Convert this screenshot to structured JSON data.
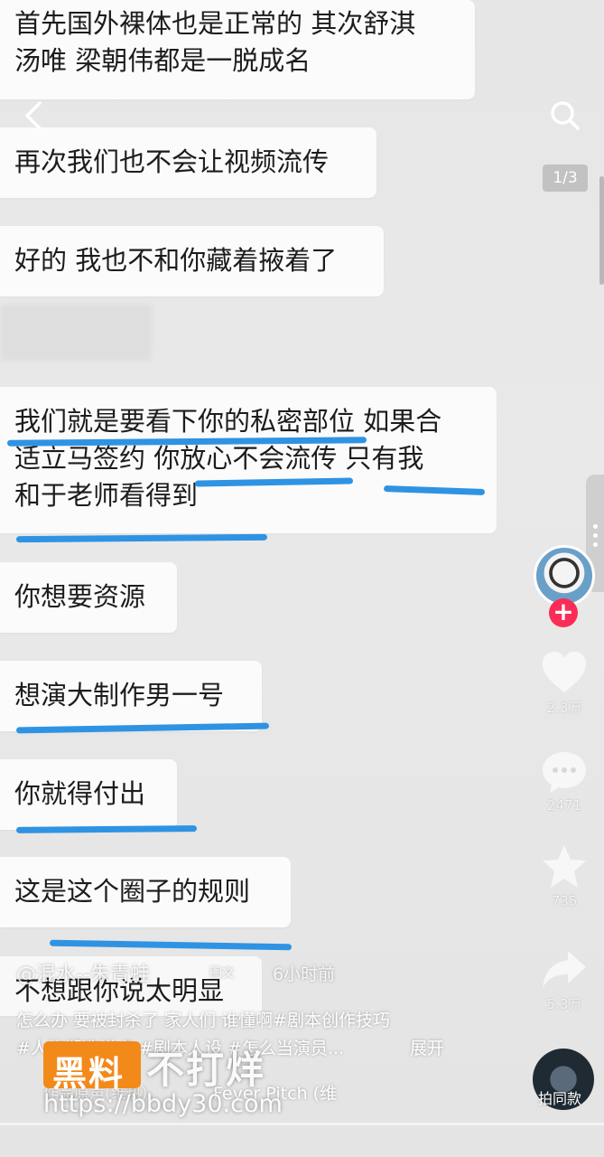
{
  "chat": {
    "messages": [
      {
        "lines": [
          "首先国外裸体也是正常的 其次舒淇",
          "汤唯 梁朝伟都是一脱成名"
        ]
      },
      {
        "lines": [
          "再次我们也不会让视频流传"
        ]
      },
      {
        "lines": [
          "好的 我也不和你藏着掖着了"
        ]
      },
      {
        "lines": [
          "我们就是要看下你的私密部位 如果合",
          "适立马签约 你放心不会流传 只有我",
          "和于老师看得到"
        ]
      },
      {
        "lines": [
          "你想要资源"
        ]
      },
      {
        "lines": [
          "想演大制作男一号"
        ]
      },
      {
        "lines": [
          "你就得付出"
        ]
      },
      {
        "lines": [
          "这是这个圈子的规则"
        ]
      },
      {
        "lines": [
          "不想跟你说太明显"
        ]
      }
    ]
  },
  "top": {
    "back_icon": "chevron-left-icon",
    "search_icon": "search-icon",
    "page_counter": "1/3"
  },
  "side": {
    "like_count": "2.3万",
    "comment_count": "2471",
    "favorite_count": "735",
    "share_count": "5.3万",
    "shoot_label": "拍同款"
  },
  "post": {
    "author": "@混水--朱青蛙",
    "type_tag": "图文",
    "time": "6小时前",
    "caption_line1": "怎么办 要被封杀了 家人们 谁懂啊#剧本创作技巧",
    "caption_line2": "#人物塑造描点 #剧本人设 #怎么当演员...",
    "expand": "展开",
    "music": "Fever Pitch (维",
    "music_prefix": "作品原声(维热)"
  },
  "watermark": {
    "brand_left": "黑料",
    "brand_right": "不打烊",
    "url": "https://bbdy30.com"
  },
  "colors": {
    "underline": "#2f93e3",
    "follow": "#fb2c55",
    "watermark": "#f28a1a"
  }
}
